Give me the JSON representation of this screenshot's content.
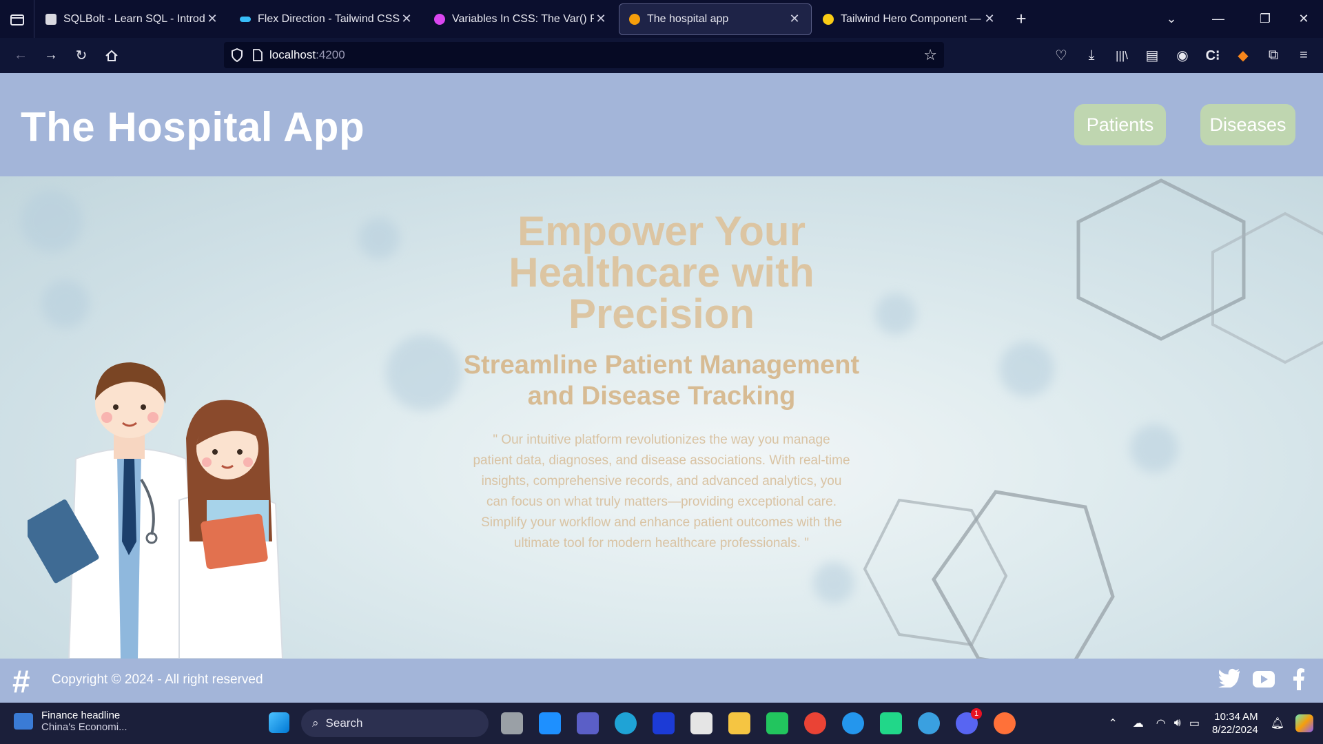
{
  "browser": {
    "tabs": [
      {
        "title": "SQLBolt - Learn SQL - Introducti",
        "favicon_color": "#d9d9e0",
        "active": false
      },
      {
        "title": "Flex Direction - Tailwind CSS",
        "favicon_color": "#38bdf8",
        "active": false
      },
      {
        "title": "Variables In CSS: The Var() Funct",
        "favicon_color": "#d946ef",
        "active": false
      },
      {
        "title": "The hospital app",
        "favicon_color": "#f59e0b",
        "active": true
      },
      {
        "title": "Tailwind Hero Component — Te",
        "favicon_color": "#facc15",
        "active": false
      }
    ],
    "url_host": "localhost",
    "url_port": ":4200"
  },
  "header": {
    "title": "The Hospital App",
    "nav": {
      "patients": "Patients",
      "diseases": "Diseases"
    }
  },
  "hero": {
    "title": "Empower Your Healthcare with Precision",
    "subtitle": "Streamline Patient Management and Disease Tracking",
    "description": "\" Our intuitive platform revolutionizes the way you manage patient data, diagnoses, and disease associations. With real-time insights, comprehensive records, and advanced analytics, you can focus on what truly matters—providing exceptional care. Simplify your workflow and enhance patient outcomes with the ultimate tool for modern healthcare professionals. \""
  },
  "footer": {
    "copyright": "Copyright © 2024 - All right reserved",
    "social_icons": [
      "twitter-icon",
      "youtube-icon",
      "facebook-icon"
    ]
  },
  "taskbar": {
    "news_title": "Finance headline",
    "news_sub": "China's Economi...",
    "search_placeholder": "Search",
    "time": "10:34 AM",
    "date": "8/22/2024",
    "discord_badge": "1"
  },
  "colors": {
    "header_bg": "#a3b5d9",
    "button_bg": "#bfd6b0",
    "hero_text": "#dcc5a2",
    "browser_bg": "#0b0f2e"
  }
}
